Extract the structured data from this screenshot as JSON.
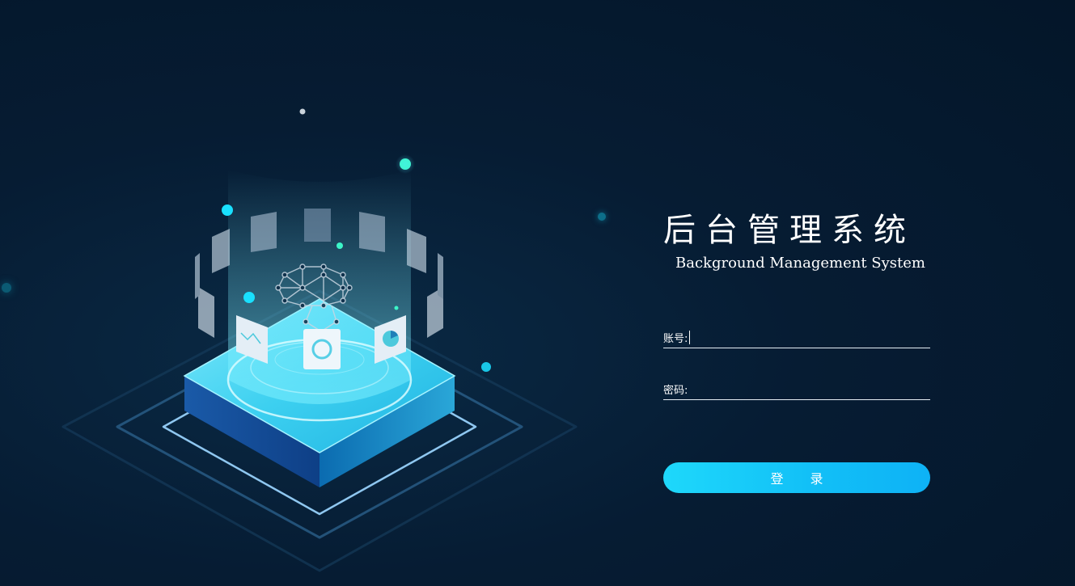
{
  "header": {
    "title_cn": "后台管理系统",
    "title_en": "Background Management System"
  },
  "form": {
    "account_label": "账号:",
    "account_value": "",
    "password_label": "密码:",
    "password_value": "",
    "login_label": "登 录"
  },
  "colors": {
    "background": "#061c33",
    "accent": "#1ed8fb",
    "accent_end": "#0eb2f6",
    "glow_green": "#3cf5c8"
  },
  "illustration": {
    "icons": [
      "brain-network-icon",
      "document-chart-icon",
      "pie-chart-icon",
      "ring-icon"
    ]
  }
}
